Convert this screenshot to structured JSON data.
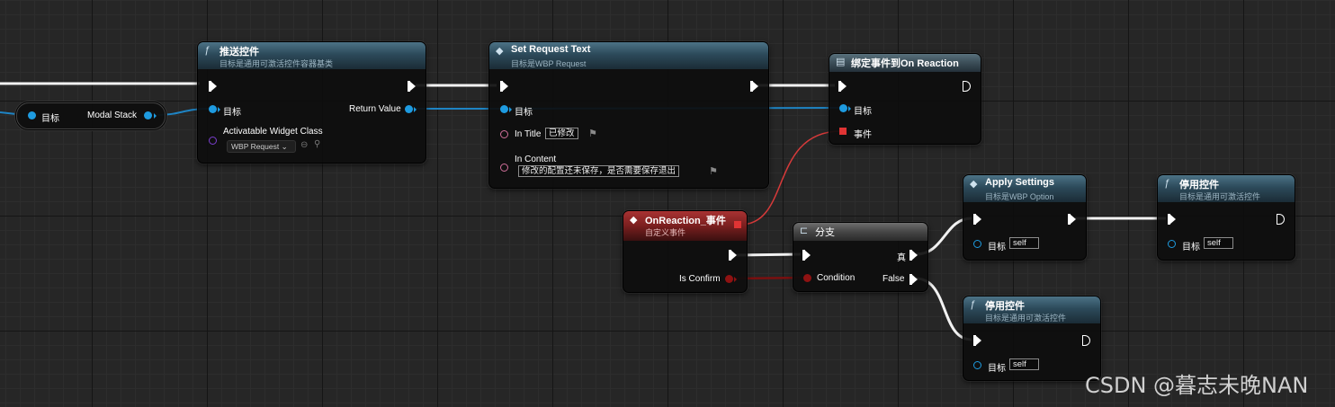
{
  "reroute": {
    "left_label": "目标",
    "right_label": "Modal Stack"
  },
  "push_node": {
    "title": "推送控件",
    "subtitle": "目标是通用可激活控件容器基类",
    "icon": "function-icon",
    "target": "目标",
    "class_pin": "Activatable Widget Class",
    "class_value": "WBP Request",
    "return": "Return Value"
  },
  "set_text_node": {
    "title": "Set Request Text",
    "subtitle": "目标是WBP Request",
    "target": "目标",
    "in_title": "In Title",
    "in_title_value": "已修改",
    "in_content": "In Content",
    "in_content_value": "修改的配置还未保存，是否需要保存退出"
  },
  "bind_node": {
    "title": "绑定事件到On Reaction",
    "target": "目标",
    "event": "事件"
  },
  "custom_event": {
    "title": "OnReaction_事件",
    "subtitle": "自定义事件",
    "is_confirm": "Is Confirm"
  },
  "branch": {
    "title": "分支",
    "condition": "Condition",
    "true": "真",
    "false": "False"
  },
  "apply_settings": {
    "title": "Apply Settings",
    "subtitle": "目标是WBP Option",
    "target": "目标",
    "self": "self"
  },
  "deactivate_top": {
    "title": "停用控件",
    "subtitle": "目标是通用可激活控件",
    "target": "目标",
    "self": "self"
  },
  "deactivate_bottom": {
    "title": "停用控件",
    "subtitle": "目标是通用可激活控件",
    "target": "目标",
    "self": "self"
  },
  "watermark": "CSDN @暮志未晚NAN",
  "colors": {
    "exec": "#ffffff",
    "object": "#1e9be0",
    "text": "#d06f9a",
    "class": "#7b3fd0",
    "bool": "#8f1212",
    "delegate": "#e03434",
    "event_header": "#a83232",
    "function_header": "#2c4a5a"
  }
}
